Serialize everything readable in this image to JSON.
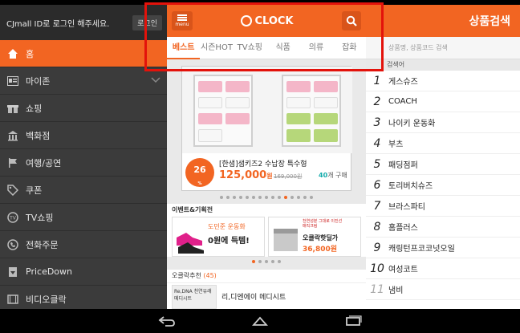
{
  "sidebar": {
    "login_text": "CJmall ID로 로그인 해주세요.",
    "login_button": "로그인",
    "items": [
      {
        "label": "홈",
        "icon": "home-icon",
        "active": true
      },
      {
        "label": "마이존",
        "icon": "profile-card-icon",
        "active": false
      },
      {
        "label": "쇼핑",
        "icon": "gift-icon",
        "active": false
      },
      {
        "label": "백화점",
        "icon": "building-icon",
        "active": false
      },
      {
        "label": "여행/공연",
        "icon": "flag-icon",
        "active": false
      },
      {
        "label": "쿠폰",
        "icon": "tag-icon",
        "active": false
      },
      {
        "label": "TV쇼핑",
        "icon": "tv-icon",
        "active": false
      },
      {
        "label": "전화주문",
        "icon": "phone-icon",
        "active": false
      },
      {
        "label": "PriceDown",
        "icon": "price-down-icon",
        "active": false
      },
      {
        "label": "비디오클락",
        "icon": "video-icon",
        "active": false
      }
    ]
  },
  "app": {
    "menu_label": "menu",
    "logo_text": "CLOCK",
    "tabs": [
      "베스트",
      "시즌HOT",
      "TV쇼핑",
      "식품",
      "의류",
      "잡화"
    ],
    "active_tab": "베스트",
    "deal": {
      "badge_number": "26",
      "badge_sub": "%",
      "title": "[한샘]샘키즈2 수납장 특수형",
      "price": "125,000",
      "price_unit": "원",
      "original_price": "169,000원",
      "count_number": "40",
      "count_suffix": "개 구매"
    },
    "events_title": "이벤트&기획전",
    "event1": {
      "sub": "도민준 운동화",
      "main": "0원에 득템!"
    },
    "event2": {
      "small": "천연성분 그대로 이진선 매직크림",
      "name": "오클락핫딜가",
      "price": "36,800원"
    },
    "recommend_title": "오클락추천",
    "recommend_count": "(45)",
    "recommend_item": {
      "thumb_text": "Re,DNA 천연유래 메디시트",
      "name": "리,디엔에이 메디시트"
    }
  },
  "right": {
    "title": "상품검색",
    "search_placeholder": "상품명, 상품코드 검색",
    "sub_title": "검색어",
    "rankings": [
      {
        "rank": "1",
        "term": "게스슈즈"
      },
      {
        "rank": "2",
        "term": "COACH"
      },
      {
        "rank": "3",
        "term": "나이키 운동화"
      },
      {
        "rank": "4",
        "term": "부츠"
      },
      {
        "rank": "5",
        "term": "패딩점퍼"
      },
      {
        "rank": "6",
        "term": "토리버치슈즈"
      },
      {
        "rank": "7",
        "term": "브라스파티"
      },
      {
        "rank": "8",
        "term": "홈플러스"
      },
      {
        "rank": "9",
        "term": "캐링턴프코코넛오일"
      },
      {
        "rank": "10",
        "term": "여성코트"
      },
      {
        "rank": "11",
        "term": "냄비"
      }
    ]
  },
  "colors": {
    "accent": "#f26522",
    "highlight": "#e3120b",
    "sidebar": "#3b3b3b"
  }
}
